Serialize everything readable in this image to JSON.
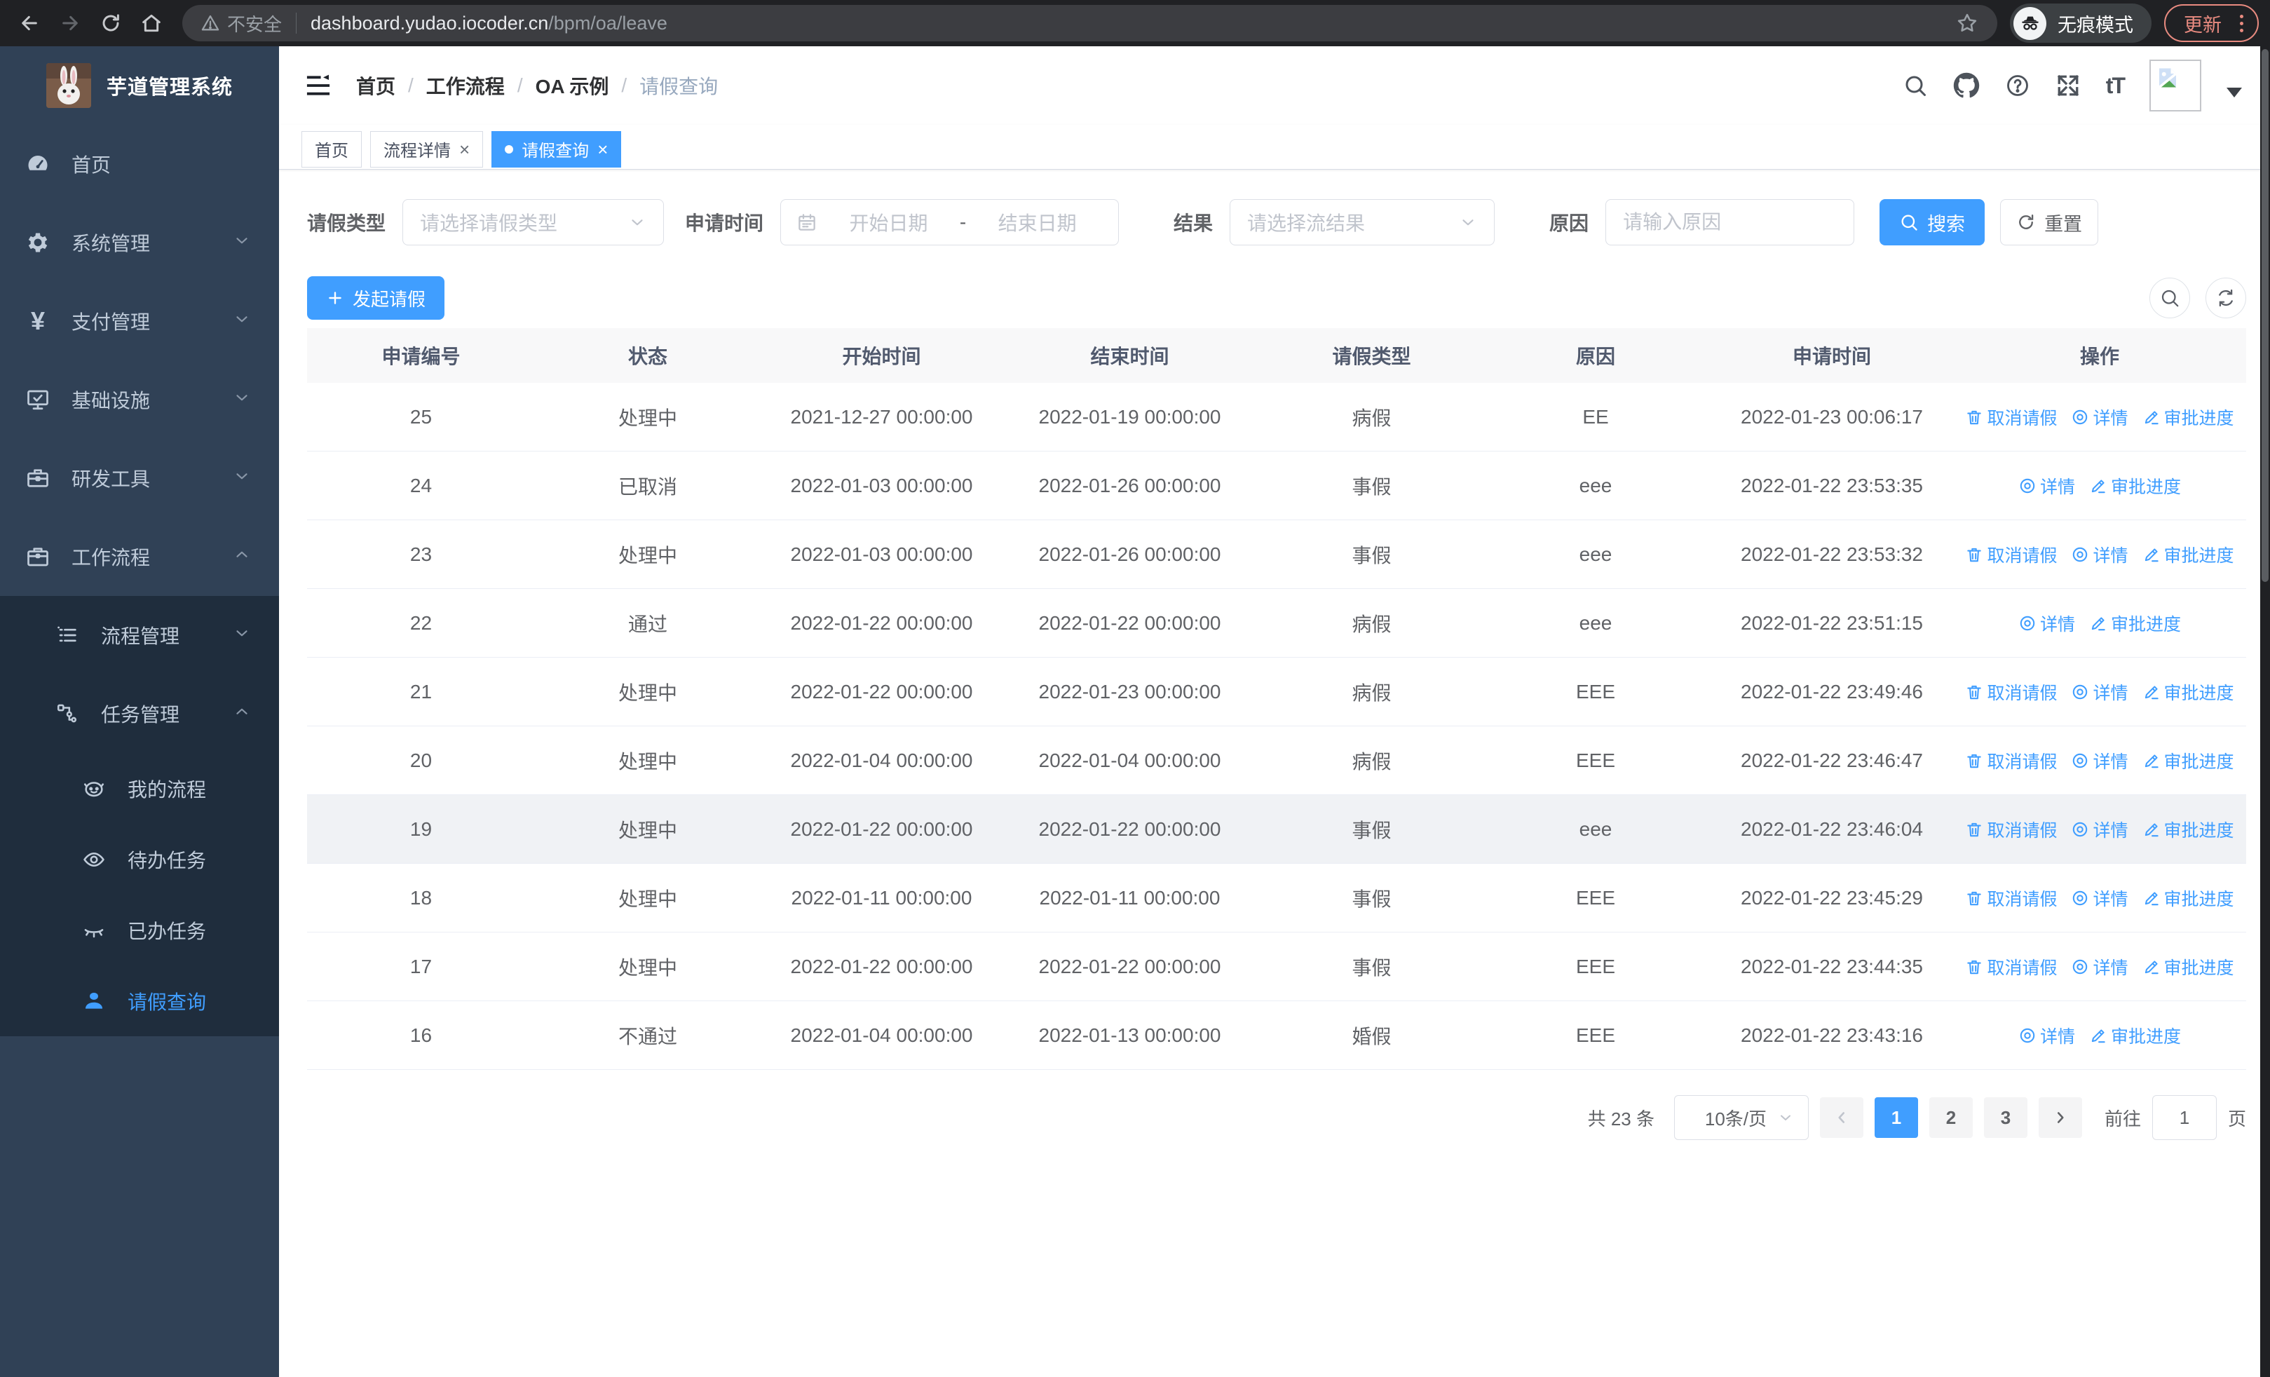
{
  "browser": {
    "security_label": "不安全",
    "url_host": "dashboard.yudao.iocoder.cn",
    "url_path": "/bpm/oa/leave",
    "incognito_label": "无痕模式",
    "update_label": "更新"
  },
  "icons": {
    "font_size_glyph": "tT"
  },
  "sidebar": {
    "title": "芋道管理系统",
    "items": [
      {
        "label": "首页",
        "icon": "dashboard-icon"
      },
      {
        "label": "系统管理",
        "icon": "gear-icon"
      },
      {
        "label": "支付管理",
        "icon": "yen-icon"
      },
      {
        "label": "基础设施",
        "icon": "monitor-icon"
      },
      {
        "label": "研发工具",
        "icon": "toolbox-icon"
      },
      {
        "label": "工作流程",
        "icon": "briefcase-icon"
      }
    ],
    "submenu": [
      {
        "label": "流程管理",
        "icon": "list-icon"
      },
      {
        "label": "任务管理",
        "icon": "flow-icon"
      }
    ],
    "tasks": [
      {
        "label": "我的流程",
        "icon": "face-icon"
      },
      {
        "label": "待办任务",
        "icon": "eye-open-icon"
      },
      {
        "label": "已办任务",
        "icon": "eye-closed-icon"
      },
      {
        "label": "请假查询",
        "icon": "user-icon",
        "active": true
      }
    ]
  },
  "header": {
    "breadcrumb": [
      "首页",
      "工作流程",
      "OA 示例",
      "请假查询"
    ],
    "tabs": [
      {
        "label": "首页",
        "closable": false,
        "active": false
      },
      {
        "label": "流程详情",
        "closable": true,
        "active": false
      },
      {
        "label": "请假查询",
        "closable": true,
        "active": true
      }
    ]
  },
  "filters": {
    "leave_type_label": "请假类型",
    "leave_type_placeholder": "请选择请假类型",
    "apply_time_label": "申请时间",
    "start_placeholder": "开始日期",
    "range_separator": "-",
    "end_placeholder": "结束日期",
    "result_label": "结果",
    "result_placeholder": "请选择流结果",
    "reason_label": "原因",
    "reason_placeholder": "请输入原因",
    "search_label": "搜索",
    "reset_label": "重置"
  },
  "toolbar": {
    "create_label": "发起请假"
  },
  "table": {
    "columns": [
      "申请编号",
      "状态",
      "开始时间",
      "结束时间",
      "请假类型",
      "原因",
      "申请时间",
      "操作"
    ],
    "action_labels": {
      "cancel": "取消请假",
      "detail": "详情",
      "progress": "审批进度"
    },
    "rows": [
      {
        "id": "25",
        "status": "处理中",
        "start": "2021-12-27 00:00:00",
        "end": "2022-01-19 00:00:00",
        "type": "病假",
        "reason": "EE",
        "applied": "2022-01-23 00:06:17",
        "cancellable": true
      },
      {
        "id": "24",
        "status": "已取消",
        "start": "2022-01-03 00:00:00",
        "end": "2022-01-26 00:00:00",
        "type": "事假",
        "reason": "eee",
        "applied": "2022-01-22 23:53:35",
        "cancellable": false
      },
      {
        "id": "23",
        "status": "处理中",
        "start": "2022-01-03 00:00:00",
        "end": "2022-01-26 00:00:00",
        "type": "事假",
        "reason": "eee",
        "applied": "2022-01-22 23:53:32",
        "cancellable": true
      },
      {
        "id": "22",
        "status": "通过",
        "start": "2022-01-22 00:00:00",
        "end": "2022-01-22 00:00:00",
        "type": "病假",
        "reason": "eee",
        "applied": "2022-01-22 23:51:15",
        "cancellable": false
      },
      {
        "id": "21",
        "status": "处理中",
        "start": "2022-01-22 00:00:00",
        "end": "2022-01-23 00:00:00",
        "type": "病假",
        "reason": "EEE",
        "applied": "2022-01-22 23:49:46",
        "cancellable": true
      },
      {
        "id": "20",
        "status": "处理中",
        "start": "2022-01-04 00:00:00",
        "end": "2022-01-04 00:00:00",
        "type": "病假",
        "reason": "EEE",
        "applied": "2022-01-22 23:46:47",
        "cancellable": true
      },
      {
        "id": "19",
        "status": "处理中",
        "start": "2022-01-22 00:00:00",
        "end": "2022-01-22 00:00:00",
        "type": "事假",
        "reason": "eee",
        "applied": "2022-01-22 23:46:04",
        "cancellable": true,
        "hover": true
      },
      {
        "id": "18",
        "status": "处理中",
        "start": "2022-01-11 00:00:00",
        "end": "2022-01-11 00:00:00",
        "type": "事假",
        "reason": "EEE",
        "applied": "2022-01-22 23:45:29",
        "cancellable": true
      },
      {
        "id": "17",
        "status": "处理中",
        "start": "2022-01-22 00:00:00",
        "end": "2022-01-22 00:00:00",
        "type": "事假",
        "reason": "EEE",
        "applied": "2022-01-22 23:44:35",
        "cancellable": true
      },
      {
        "id": "16",
        "status": "不通过",
        "start": "2022-01-04 00:00:00",
        "end": "2022-01-13 00:00:00",
        "type": "婚假",
        "reason": "EEE",
        "applied": "2022-01-22 23:43:16",
        "cancellable": false
      }
    ]
  },
  "pagination": {
    "total_label": "共 23 条",
    "page_size": "10条/页",
    "pages": [
      "1",
      "2",
      "3"
    ],
    "current_page": "1",
    "goto_label": "前往",
    "goto_value": "1",
    "page_unit": "页"
  },
  "colors": {
    "primary": "#409eff",
    "sidebar_bg": "#304156",
    "submenu_bg": "#1f2d3d",
    "update_accent": "#e98b80"
  }
}
